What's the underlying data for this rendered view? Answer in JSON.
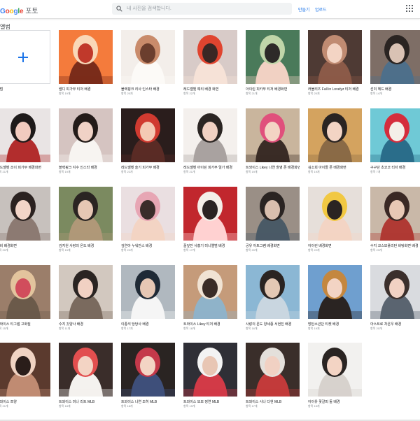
{
  "header": {
    "logo_g": "G",
    "logo_o1": "o",
    "logo_o2": "o",
    "logo_g2": "g",
    "logo_l": "l",
    "logo_e": "e",
    "product": "포토",
    "search_placeholder": "내 사진을 검색합니다.",
    "create_label": "만들기",
    "upload_label": "업로드"
  },
  "section_title": "앨범",
  "new_album_label": "앨범",
  "albums": [
    {
      "title": "웬디 피가부 티저 배경",
      "count": "항목 19개",
      "palette": [
        "#f47b3c",
        "#f9d8b8",
        "#c0392b",
        "#7a2c1a"
      ]
    },
    {
      "title": "블랙핑크 리사 인스타 배경",
      "count": "항목 20개",
      "palette": [
        "#f3eeea",
        "#c98b6b",
        "#6b3e2e",
        "#fcfaf7"
      ]
    },
    {
      "title": "레드벨벳 예리 배경 화면",
      "count": "항목 22개",
      "palette": [
        "#d8cbc8",
        "#e0442f",
        "#3a2724",
        "#f6e2d7"
      ]
    },
    {
      "title": "아이린 피카부 티저 배경화면",
      "count": "항목 21개",
      "palette": [
        "#4a7a5a",
        "#c0d6a9",
        "#2d2a28",
        "#f1d1c3"
      ]
    },
    {
      "title": "러블리즈 Fall in Lovelyz 티저 배경",
      "count": "항목 20개",
      "palette": [
        "#4e3a34",
        "#c08b72",
        "#f3d4c4",
        "#8b5a48"
      ]
    },
    {
      "title": "선미 헤드 배경",
      "count": "항목 14개",
      "palette": [
        "#7e6e66",
        "#2a2422",
        "#d9c2b4",
        "#4e6f8a"
      ]
    },
    {
      "title": "레드벨벳 조이 피가부 배경화면",
      "count": "항목 21개",
      "palette": [
        "#e9e4e4",
        "#1e1a1a",
        "#f2cbbf",
        "#b22d2d"
      ]
    },
    {
      "title": "블랙핑크 지수 인스타 배경",
      "count": "항목 19개",
      "palette": [
        "#d5c4c1",
        "#231b19",
        "#f0d2c6",
        "#f7f4f1"
      ]
    },
    {
      "title": "레드벨벳 슬기 피가부 배경",
      "count": "항목 22개",
      "palette": [
        "#2a1d1c",
        "#d03a30",
        "#f4c9b4",
        "#5a2b25"
      ]
    },
    {
      "title": "레드벨벳 아이린 피가부 얼가 배경",
      "count": "항목 21개",
      "palette": [
        "#f4f0ed",
        "#2b2523",
        "#f1d1c3",
        "#a9a2a0"
      ]
    },
    {
      "title": "트와이스 Likey 나연 촬영 폰 배경화면",
      "count": "항목 19개",
      "palette": [
        "#c9b59d",
        "#e0507c",
        "#f3d4c4",
        "#3a2c26"
      ]
    },
    {
      "title": "김소희 아이돌 폰 배경화면",
      "count": "항목 19개",
      "palette": [
        "#d4a35f",
        "#2a2422",
        "#f3d4c4",
        "#8a6a46"
      ]
    },
    {
      "title": "구구단 초코코 티저 배경",
      "count": "항목 7개",
      "palette": [
        "#6fc9d6",
        "#d52d3c",
        "#f4efe8",
        "#2a6d8a"
      ]
    },
    {
      "title": "다비 배경화면",
      "count": "항목 20개",
      "palette": [
        "#c7c1bd",
        "#2b2220",
        "#f2d5c8",
        "#8c7a72"
      ]
    },
    {
      "title": "김지원 사랑의 온도 배경",
      "count": "항목 15개",
      "palette": [
        "#7b8a60",
        "#2a2422",
        "#e6c7b4",
        "#b09878"
      ]
    },
    {
      "title": "김연아 누워잔스 배경",
      "count": "항목 22개",
      "palette": [
        "#eadfe1",
        "#e7a6b4",
        "#3a2c2a",
        "#f3d4c4"
      ]
    },
    {
      "title": "꿀잎잔 사홍기 미니앨범 배경",
      "count": "항목 17개",
      "palette": [
        "#c1272d",
        "#f4efe8",
        "#2a2422",
        "#ffd1d1"
      ]
    },
    {
      "title": "공유 아트그램 배경화면",
      "count": "항목 20개",
      "palette": [
        "#9a8f86",
        "#2a2422",
        "#d9bfae",
        "#4a5a66"
      ]
    },
    {
      "title": "아이린 배경화면",
      "count": "항목 22개",
      "palette": [
        "#e6dfda",
        "#f1c842",
        "#2a2422",
        "#f3d4c4"
      ]
    },
    {
      "title": "수지 코스모폴리탄 바탕화면 배경",
      "count": "항목 23개",
      "palette": [
        "#c9b8a8",
        "#3a2824",
        "#e7c8b5",
        "#b03a34"
      ]
    },
    {
      "title": "트와이스 티그램 고화질",
      "count": "항목 15개",
      "palette": [
        "#9b7e6a",
        "#e3c49d",
        "#d14d5c",
        "#6b5a4a"
      ]
    },
    {
      "title": "수지 갓양사 배경",
      "count": "항목 11개",
      "palette": [
        "#d2c8bf",
        "#2a2422",
        "#f1d1c3",
        "#7a6a5e"
      ]
    },
    {
      "title": "이종석 당당사 배경",
      "count": "항목 17개",
      "palette": [
        "#b0b8bf",
        "#1f2a36",
        "#e6c7b4",
        "#f5f5f5"
      ]
    },
    {
      "title": "트와이스 Likey 티저 배경",
      "count": "항목 18개",
      "palette": [
        "#c59b7a",
        "#f0e3d4",
        "#3a2c26",
        "#8fb3c9"
      ]
    },
    {
      "title": "사랑의 온도 양세종 서현진 배경",
      "count": "항목 16개",
      "palette": [
        "#8bb7d4",
        "#2a2422",
        "#e3c8b4",
        "#c9d6e0"
      ]
    },
    {
      "title": "방탄소년단 티켓 배경",
      "count": "항목 19개",
      "palette": [
        "#6f9fcf",
        "#c4873f",
        "#f3d4c4",
        "#2a2422"
      ]
    },
    {
      "title": "아스트로 차은우 배경",
      "count": "항목 20개",
      "palette": [
        "#d9dbdf",
        "#3b2f2c",
        "#f1d1c3",
        "#5a6470"
      ]
    },
    {
      "title": "트와이스 쯔양",
      "count": "항목 21개",
      "palette": [
        "#5b3a2e",
        "#f0d3c3",
        "#2a1d1a",
        "#c08b72"
      ]
    },
    {
      "title": "트와이스 미나 리트 MLB",
      "count": "항목 18개",
      "palette": [
        "#3a2d2a",
        "#e24f4f",
        "#f3d4c4",
        "#f4f2ef"
      ]
    },
    {
      "title": "트와이스 나연 조히 MLB",
      "count": "항목 18개",
      "palette": [
        "#2a2422",
        "#c4394a",
        "#f3d4c4",
        "#3e4f7a"
      ]
    },
    {
      "title": "트와이스 모모 정연 MLB",
      "count": "항목 19개",
      "palette": [
        "#2f2f36",
        "#f3f3f3",
        "#e8c6b4",
        "#d23a47"
      ]
    },
    {
      "title": "트와이스 사나 다현 MLB",
      "count": "항목 17개",
      "palette": [
        "#3a2e2a",
        "#e4e0db",
        "#f1d1c3",
        "#c23a3a"
      ]
    },
    {
      "title": "아이유 꽃갈피 둘 배경",
      "count": "항목 15개",
      "palette": [
        "#f2f1ef",
        "#2a2422",
        "#f3d4c4",
        "#d7d2cd"
      ]
    }
  ]
}
